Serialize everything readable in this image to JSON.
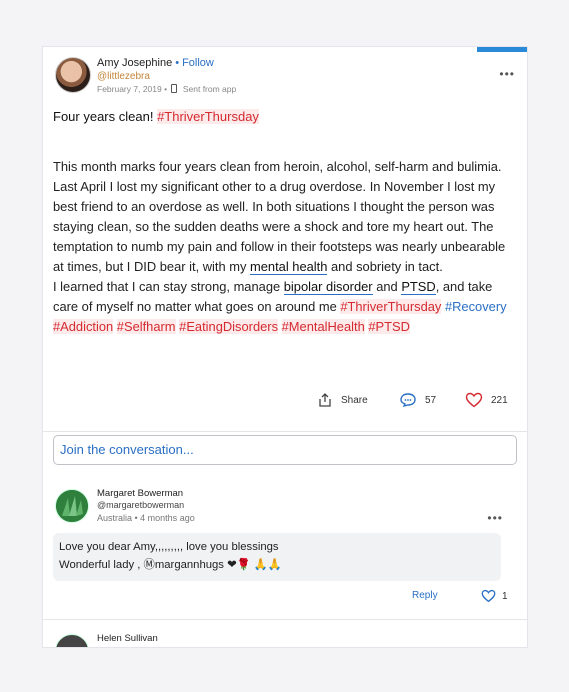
{
  "post": {
    "author": "Amy Josephine",
    "separator": "•",
    "follow_label": "Follow",
    "handle": "@littlezebra",
    "date": "February 7, 2019",
    "date_sep": "•",
    "source": "Sent from app",
    "more_label": "•••",
    "title_text": "Four years clean!",
    "title_tag": "#ThriverThursday",
    "body": {
      "p1": "This month marks four years clean from heroin, alcohol, self-harm and bulimia. Last April I lost my significant other to a drug overdose. In November I lost my best friend to an overdose as well. In both situations I thought the person was staying clean, so the sudden deaths were a shock and tore my heart out. The temptation to numb my pain and follow in their footsteps was nearly unbearable at times, but I DID bear it, with my",
      "p1_link": "mental health",
      "p1_end": "and sobriety in tact.",
      "p2_start": "I learned that I can stay strong, manage",
      "p2_link1": "bipolar disorder",
      "p2_and": "and",
      "p2_link2": "PTSD",
      "p2_mid": ", and take care of myself no matter what goes on around me",
      "tags": [
        "#ThriverThursday",
        "#Recovery",
        "#Addiction",
        "#Selfharm",
        "#EatingDisorders",
        "#MentalHealth",
        "#PTSD"
      ]
    },
    "share_label": "Share",
    "comment_count": "57",
    "like_count": "221",
    "accent_color": "#2a8ad8",
    "tag_color": "#d42a30"
  },
  "join": {
    "placeholder": "Join the conversation..."
  },
  "comments": [
    {
      "name": "Margaret Bowerman",
      "handle": "@margaretbowerman",
      "meta": "Australia • 4 months ago",
      "more": "•••",
      "line1": "Love you dear Amy,,,,,,,,, love you blessings",
      "line2": "Wonderful lady , Ⓜmargannhugs ❤🌹 🙏🙏",
      "reply_label": "Reply",
      "likes": "1"
    },
    {
      "name": "Helen Sullivan"
    }
  ]
}
